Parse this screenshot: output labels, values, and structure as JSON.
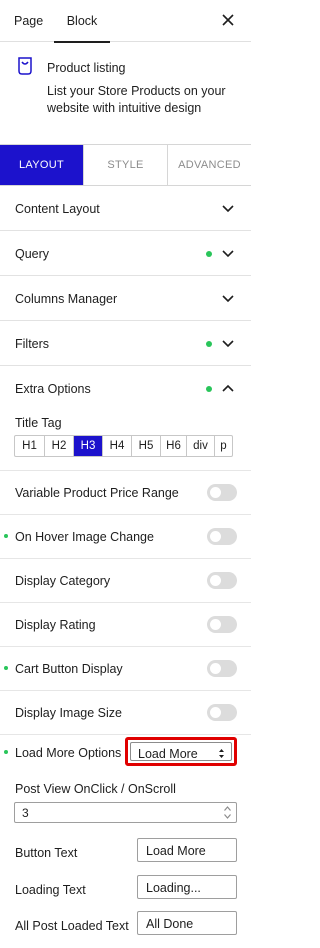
{
  "tabs": {
    "page": "Page",
    "block": "Block"
  },
  "block_info": {
    "title": "Product listing",
    "description": "List your Store Products on your website with intuitive design"
  },
  "layout_tabs": [
    "LAYOUT",
    "STYLE",
    "ADVANCED"
  ],
  "panels": {
    "content_layout": "Content Layout",
    "query": "Query",
    "columns_manager": "Columns Manager",
    "filters": "Filters",
    "extra_options": "Extra Options"
  },
  "extra_options": {
    "title_tag_label": "Title Tag",
    "title_tags": [
      "H1",
      "H2",
      "H3",
      "H4",
      "H5",
      "H6",
      "div",
      "p"
    ],
    "selected_tag": "H3",
    "toggles": [
      "Variable Product Price Range",
      "On Hover Image Change",
      "Display Category",
      "Display Rating",
      "Cart Button Display",
      "Display Image Size"
    ],
    "load_more_label": "Load More Options",
    "load_more_value": "Load More",
    "post_view_label": "Post View OnClick / OnScroll",
    "post_view_value": "3",
    "button_text_label": "Button Text",
    "button_text_value": "Load More",
    "loading_text_label": "Loading Text",
    "loading_text_value": "Loading...",
    "all_loaded_label": "All Post Loaded Text",
    "all_loaded_value": "All Done"
  },
  "colors": {
    "accent": "#1c12cc",
    "status_dot": "#29c55a",
    "highlight_border": "#e00000",
    "toggle_off": "#dcdcdc"
  },
  "icons": [
    "close-icon",
    "product-listing-icon",
    "chevron-down-icon",
    "chevron-up-icon",
    "select-caret-icon",
    "spinner-arrows-icon"
  ]
}
